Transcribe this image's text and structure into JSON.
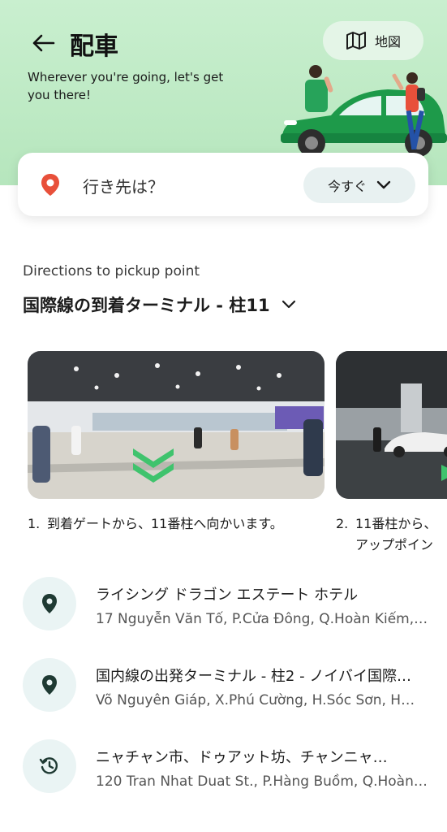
{
  "header": {
    "title": "配車",
    "subtitle": "Wherever you're going, let's get you there!",
    "map_label": "地図"
  },
  "search": {
    "placeholder": "行き先は？",
    "time_label": "今すぐ"
  },
  "pickup": {
    "section_label": "Directions to pickup point",
    "selected_point": "国際線の到着ターミナル - 柱11"
  },
  "steps": [
    {
      "number": "1.",
      "text": "到着ゲートから、11番柱へ向かいます。"
    },
    {
      "number": "2.",
      "text": "11番柱から、アップポイン"
    }
  ],
  "places": [
    {
      "icon": "location-pin-icon",
      "name": "ライシング ドラゴン エステート ホテル",
      "address": "17 Nguyễn Văn Tố, P.Cửa Đông, Q.Hoàn Kiếm,…"
    },
    {
      "icon": "location-pin-icon",
      "name": "国内線の出発ターミナル - 柱2 - ノイバイ国際…",
      "address": "Võ Nguyên Giáp, X.Phú Cường, H.Sóc Sơn, H…"
    },
    {
      "icon": "history-icon",
      "name": "ニャチャン市、ドゥアット坊、チャンニャ…",
      "address": "120 Tran Nhat Duat St., P.Hàng Buồm, Q.Hoàn…"
    }
  ],
  "colors": {
    "hero_bg": "#c9efcf",
    "car": "#1e9a4a",
    "pin_accent": "#e8503a",
    "icon_dark": "#1f3a33"
  }
}
